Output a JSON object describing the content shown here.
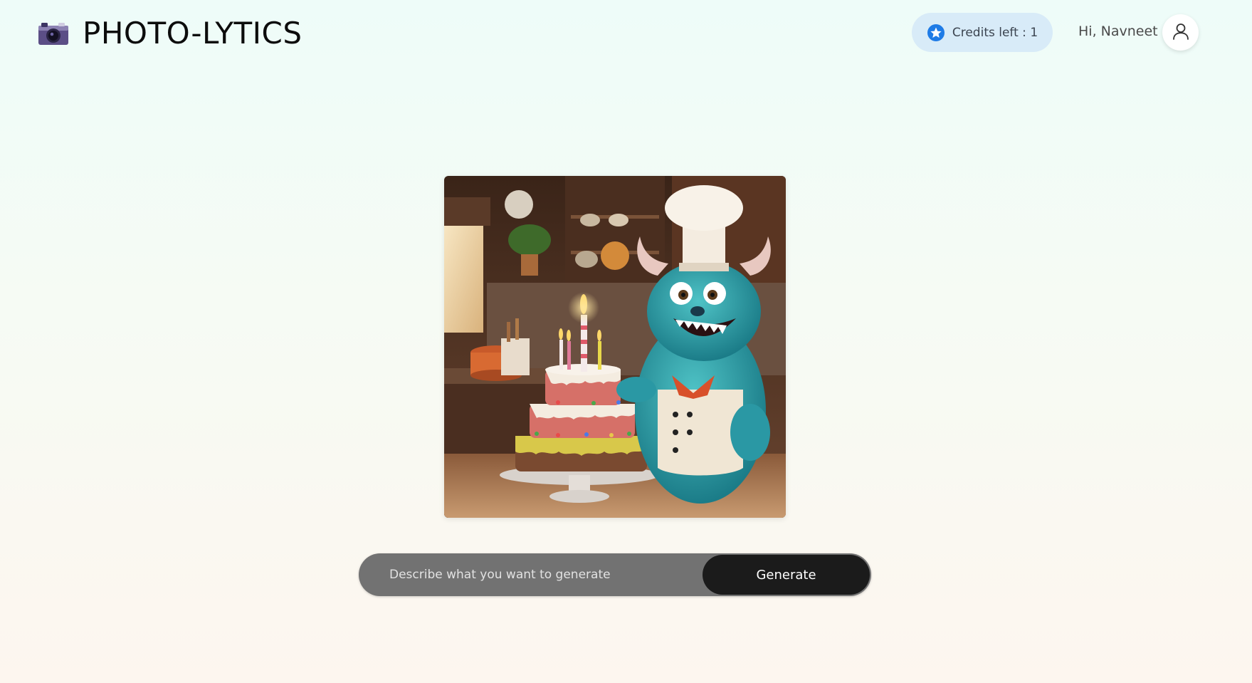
{
  "header": {
    "brand_icon": "camera-icon",
    "app_title": "PHOTO-LYTICS",
    "credits": {
      "icon": "star-badge-icon",
      "label": "Credits left : 1",
      "accent_color": "#1e7be6",
      "background": "#d8ebf8"
    },
    "greeting": "Hi, Navneet",
    "avatar_icon": "user-icon"
  },
  "main": {
    "generated_image": {
      "icon": "generated-image"
    },
    "prompt": {
      "placeholder": "Describe what you want to generate",
      "value": "",
      "button_label": "Generate"
    }
  }
}
